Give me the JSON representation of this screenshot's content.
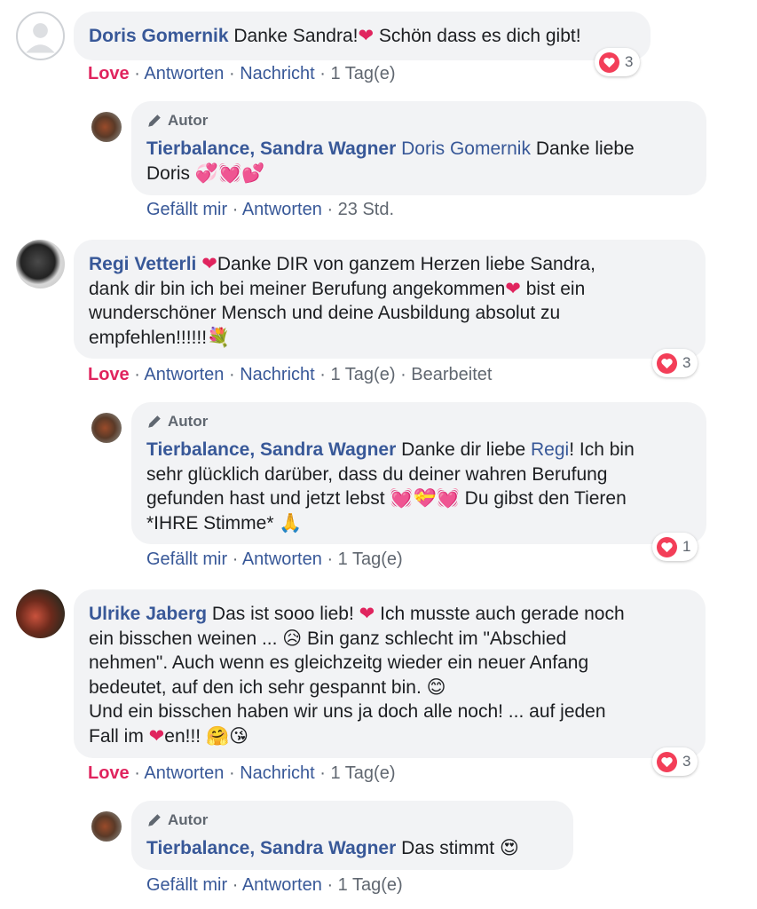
{
  "comments": [
    {
      "name": "Doris Gomernik",
      "text": "Danke Sandra!",
      "text2": " Schön dass es dich gibt!",
      "actions": {
        "love": "Love",
        "reply": "Antworten",
        "message": "Nachricht",
        "time": "1 Tag(e)"
      },
      "reaction_count": "3",
      "reply": {
        "author_tag": "Autor",
        "name": "Tierbalance, Sandra Wagner",
        "mention": "Doris Gomernik",
        "text": " Danke liebe",
        "text2": "Doris ",
        "actions": {
          "like": "Gefällt mir",
          "reply": "Antworten",
          "time": "23 Std."
        }
      }
    },
    {
      "name": "Regi Vetterli",
      "text_line1": "Danke DIR von ganzem Herzen liebe Sandra,",
      "text_line2a": "dank dir bin ich bei meiner Berufung angekommen",
      "text_line2b": " bist ein",
      "text_line3": "wunderschöner Mensch und deine Ausbildung absolut zu",
      "text_line4": "empfehlen!!!!!!",
      "actions": {
        "love": "Love",
        "reply": "Antworten",
        "message": "Nachricht",
        "time": "1 Tag(e)",
        "edited": "Bearbeitet"
      },
      "reaction_count": "3",
      "reply": {
        "author_tag": "Autor",
        "name": "Tierbalance, Sandra Wagner",
        "text_a": " Danke dir liebe ",
        "mention": "Regi",
        "text_b": "! Ich bin",
        "line2": "sehr glücklich darüber, dass du deiner wahren Berufung",
        "line3a": "gefunden hast und jetzt lebst ",
        "line3b": " Du gibst den Tieren",
        "line4": "*IHRE Stimme* ",
        "reaction_count": "1",
        "actions": {
          "like": "Gefällt mir",
          "reply": "Antworten",
          "time": "1 Tag(e)"
        }
      }
    },
    {
      "name": "Ulrike Jaberg",
      "line1a": " Das ist sooo lieb! ",
      "line1b": " Ich musste auch gerade noch",
      "line2a": "ein bisschen weinen ... ",
      "line2b": " Bin ganz schlecht im \"Abschied",
      "line3": "nehmen\". Auch wenn es gleichzeitg wieder ein neuer Anfang",
      "line4": "bedeutet, auf den ich sehr gespannt bin. ",
      "line5": "Und ein bisschen haben wir uns ja doch alle noch! ... auf jeden",
      "line6a": "Fall im ",
      "line6b": "en!!! ",
      "actions": {
        "love": "Love",
        "reply": "Antworten",
        "message": "Nachricht",
        "time": "1 Tag(e)"
      },
      "reaction_count": "3",
      "reply": {
        "author_tag": "Autor",
        "name": "Tierbalance, Sandra Wagner",
        "text": " Das stimmt ",
        "actions": {
          "like": "Gefällt mir",
          "reply": "Antworten",
          "time": "1 Tag(e)"
        }
      }
    }
  ],
  "emojis": {
    "heart": "❤",
    "hearts_combo": "💞💓💕",
    "hearts_combo2": "💓💝💓",
    "bouquet": "💐",
    "pray": "🙏",
    "sad": "😥",
    "smile": "😊",
    "hug_kiss": "🤗😘",
    "heart_eyes": "😍"
  },
  "colors": {
    "link": "#385898",
    "love": "#e0245e",
    "meta": "#606770",
    "bubble": "#f2f3f5"
  }
}
